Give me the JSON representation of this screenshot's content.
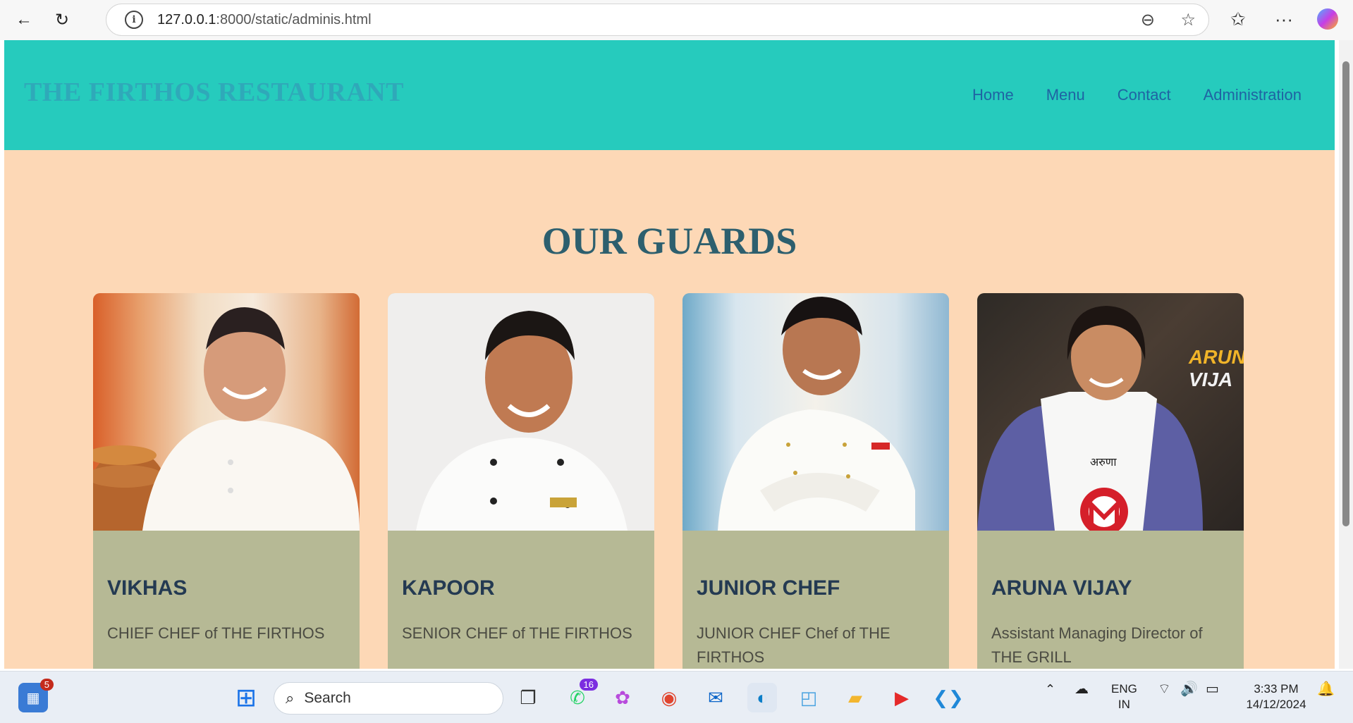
{
  "browser": {
    "url_host": "127.0.0.1",
    "url_path": ":8000/static/adminis.html",
    "info_glyph": "i"
  },
  "site": {
    "brand": "THE FIRTHOS RESTAURANT",
    "nav": [
      "Home",
      "Menu",
      "Contact",
      "Administration"
    ],
    "section_title": "OUR GUARDS",
    "cards": [
      {
        "name": "VIKHAS",
        "role": "CHIEF CHEF of THE FIRTHOS"
      },
      {
        "name": "KAPOOR",
        "role": "SENIOR CHEF of THE FIRTHOS"
      },
      {
        "name": "JUNIOR CHEF",
        "role": "JUNIOR CHEF Chef of THE FIRTHOS"
      },
      {
        "name": "ARUNA VIJAY",
        "role": "Assistant Managing Director of THE GRILL"
      }
    ],
    "photo4_overlay": "ARUNA\nVIJA",
    "photo4_apron": "अरुणा"
  },
  "taskbar": {
    "search_placeholder": "Search",
    "widgets_badge": "5",
    "whatsapp_badge": "16",
    "language": "ENG",
    "region": "IN",
    "time": "3:33 PM",
    "date": "14/12/2024"
  },
  "colors": {
    "header": "#26cbbd",
    "page": "#fdd8b6",
    "card_body": "#b6b995",
    "title": "#2d5f6e",
    "nav": "#1f63a3"
  }
}
